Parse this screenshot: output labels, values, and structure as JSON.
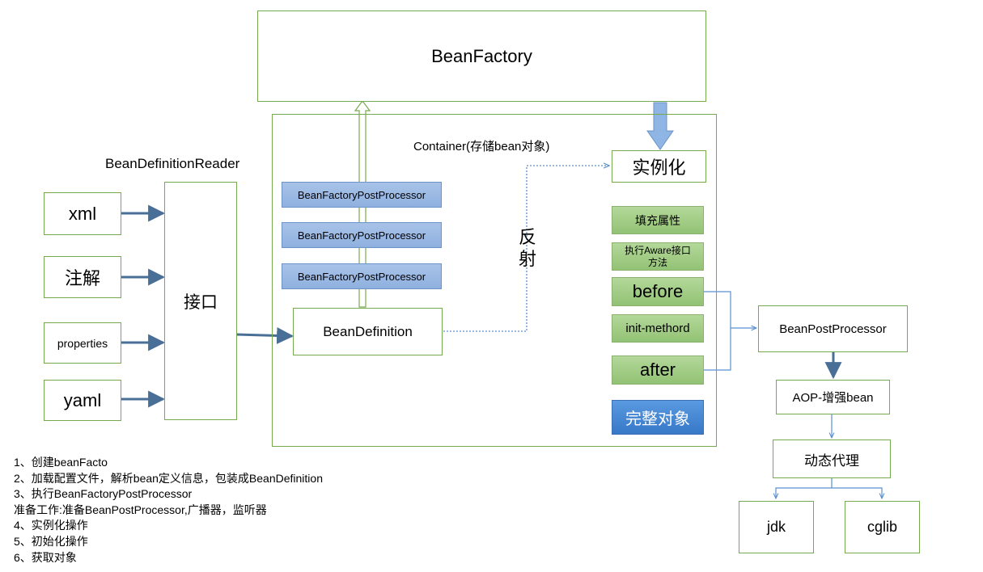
{
  "bean_factory": "BeanFactory",
  "container_label": "Container(存储bean对象)",
  "reader_title": "BeanDefinitionReader",
  "reader_box": "接口",
  "sources": [
    "xml",
    "注解",
    "properties",
    "yaml"
  ],
  "post_processors": [
    "BeanFactoryPostProcessor",
    "BeanFactoryPostProcessor",
    "BeanFactoryPostProcessor"
  ],
  "bean_definition": "BeanDefinition",
  "reflection_label": "反射",
  "instantiate": "实例化",
  "lifecycle": {
    "fill_props": "填充属性",
    "aware_line1": "执行Aware接口",
    "aware_line2": "方法",
    "before": "before",
    "init": "init-methord",
    "after": "after",
    "complete": "完整对象"
  },
  "bean_post_processor": "BeanPostProcessor",
  "aop": "AOP-增强bean",
  "dynamic_proxy": "动态代理",
  "proxy_impls": [
    "jdk",
    "cglib"
  ],
  "notes": [
    "1、创建beanFacto",
    "2、加载配置文件，解析bean定义信息，包装成BeanDefinition",
    "3、执行BeanFactoryPostProcessor",
    "准备工作:准备BeanPostProcessor,广播器，监听器",
    "4、实例化操作",
    "5、初始化操作",
    "6、获取对象"
  ],
  "colors": {
    "box_border": "#77a94f",
    "arrow_blue": "#4a6f97",
    "processor_fill": "#9dbbe4",
    "step_fill": "#a2cb84",
    "complete_fill": "#3f7fcf"
  }
}
